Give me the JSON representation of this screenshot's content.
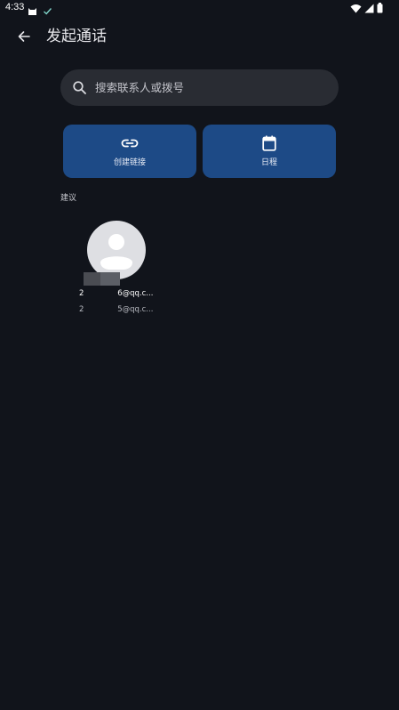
{
  "status_bar": {
    "time": "4:33",
    "left_icons": [
      "cat-icon",
      "check-icon"
    ],
    "right_icons": [
      "wifi-icon",
      "signal-icon",
      "battery-icon"
    ]
  },
  "header": {
    "back_icon": "arrow-back-icon",
    "title": "发起通话"
  },
  "search": {
    "icon": "search-icon",
    "placeholder": "搜索联系人或拨号"
  },
  "actions": [
    {
      "icon": "link-icon",
      "label": "创建链接"
    },
    {
      "icon": "calendar-icon",
      "label": "日程"
    }
  ],
  "suggestions": {
    "label": "建议",
    "contacts": [
      {
        "avatar_icon": "person-icon",
        "name": "2              6@qq.c...",
        "email": "2              5@qq.c..."
      }
    ]
  },
  "colors": {
    "background": "#11141b",
    "search_bg": "#292c33",
    "tile_bg": "#1d4a86",
    "avatar_bg": "#dedfe3"
  }
}
